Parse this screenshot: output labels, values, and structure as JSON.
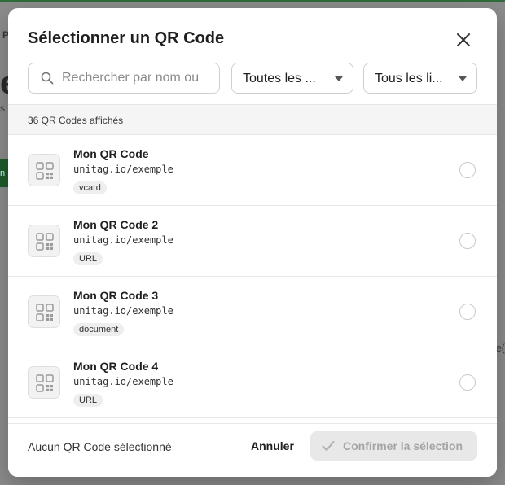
{
  "background": {
    "fragment_p": "P",
    "fragment_e": "e",
    "fragment_s": "s",
    "fragment_green": "n",
    "fragment_right": "e("
  },
  "modal": {
    "title": "Sélectionner un QR Code",
    "close_icon": "close-icon"
  },
  "filters": {
    "search_placeholder": "Rechercher par nom ou",
    "search_value": "",
    "type_select": "Toutes les ...",
    "location_select": "Tous les li..."
  },
  "count_label": "36 QR Codes affichés",
  "items": [
    {
      "name": "Mon QR Code",
      "url": "unitag.io/exemple",
      "tag": "vcard"
    },
    {
      "name": "Mon QR Code 2",
      "url": "unitag.io/exemple",
      "tag": "URL"
    },
    {
      "name": "Mon QR Code 3",
      "url": "unitag.io/exemple",
      "tag": "document"
    },
    {
      "name": "Mon QR Code 4",
      "url": "unitag.io/exemple",
      "tag": "URL"
    }
  ],
  "footer": {
    "status": "Aucun QR Code sélectionné",
    "cancel_label": "Annuler",
    "confirm_label": "Confirmer la sélection"
  },
  "colors": {
    "accent_green": "#2f6d3a",
    "disabled_bg": "#e8e8e8",
    "disabled_text": "#a5a5a5"
  }
}
